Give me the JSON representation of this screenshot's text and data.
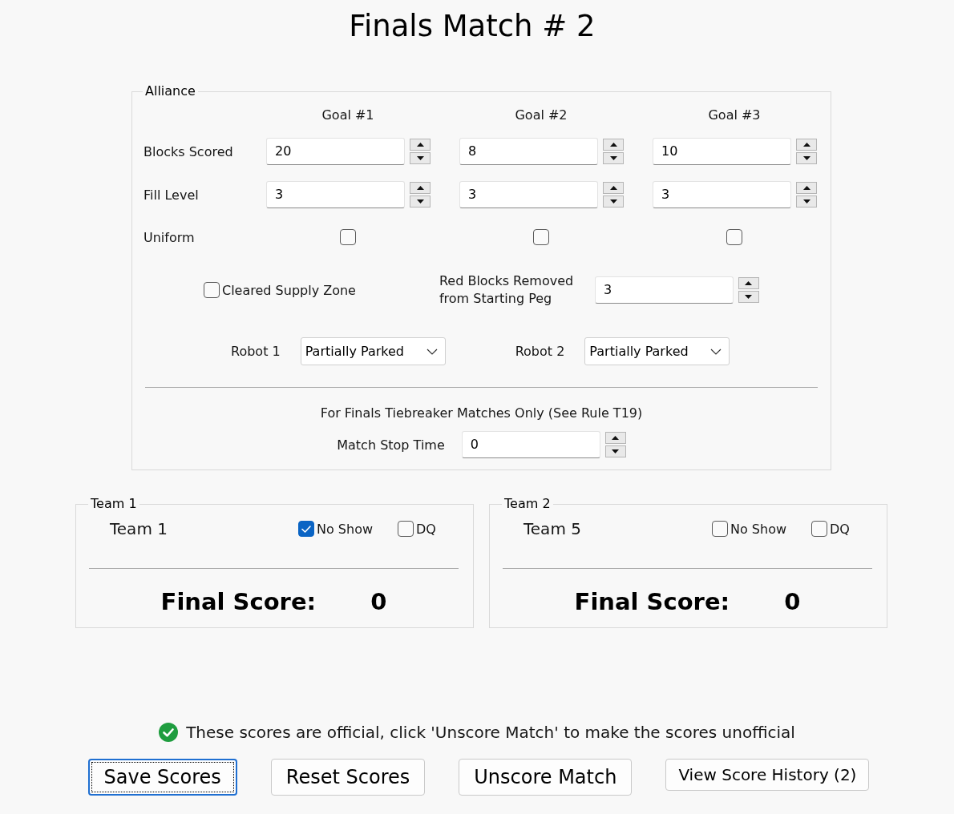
{
  "title": "Finals Match # 2",
  "alliance": {
    "legend": "Alliance",
    "columns": [
      "Goal #1",
      "Goal #2",
      "Goal #3"
    ],
    "rows": [
      {
        "label": "Blocks Scored",
        "kind": "spinner",
        "cells": [
          {
            "value": "20"
          },
          {
            "value": "8"
          },
          {
            "value": "10"
          }
        ]
      },
      {
        "label": "Fill Level",
        "kind": "spinner",
        "cells": [
          {
            "value": "3"
          },
          {
            "value": "3"
          },
          {
            "value": "3"
          }
        ]
      },
      {
        "label": "Uniform",
        "kind": "checkbox",
        "cells": [
          {
            "checked": false
          },
          {
            "checked": false
          },
          {
            "checked": false
          }
        ]
      }
    ],
    "cleared_supply_zone": {
      "label": "Cleared Supply Zone",
      "checked": false
    },
    "red_blocks_removed": {
      "label": "Red Blocks Removed from Starting Peg",
      "value": "3"
    },
    "robots": [
      {
        "label": "Robot 1",
        "value": "Partially Parked"
      },
      {
        "label": "Robot 2",
        "value": "Partially Parked"
      }
    ],
    "tiebreaker": {
      "note": "For Finals Tiebreaker Matches Only (See Rule T19)",
      "label": "Match Stop Time",
      "value": "0"
    }
  },
  "teams": [
    {
      "legend": "Team 1",
      "name": "Team 1",
      "no_show": {
        "label": "No Show",
        "checked": true
      },
      "dq": {
        "label": "DQ",
        "checked": false
      },
      "final_score_label": "Final Score:",
      "final_score": "0"
    },
    {
      "legend": "Team 2",
      "name": "Team 5",
      "no_show": {
        "label": "No Show",
        "checked": false
      },
      "dq": {
        "label": "DQ",
        "checked": false
      },
      "final_score_label": "Final Score:",
      "final_score": "0"
    }
  ],
  "status": {
    "kind": "official",
    "text": "These scores are official, click 'Unscore Match' to make the scores unofficial"
  },
  "buttons": [
    {
      "label": "Save Scores",
      "kind": "large",
      "focused": true
    },
    {
      "label": "Reset Scores",
      "kind": "large",
      "focused": false
    },
    {
      "label": "Unscore Match",
      "kind": "large",
      "focused": false
    },
    {
      "label": "View Score History (2)",
      "kind": "small",
      "focused": false
    }
  ]
}
